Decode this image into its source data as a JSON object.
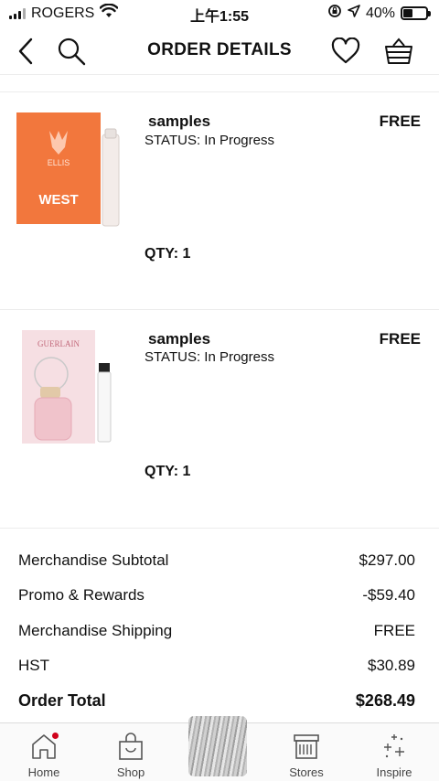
{
  "status_bar": {
    "carrier": "ROGERS",
    "time": "上午1:55",
    "battery_percent": "40%",
    "battery_level": 0.4
  },
  "nav": {
    "title": "ORDER DETAILS",
    "back_icon": "chevron-left-icon",
    "search_icon": "search-icon",
    "wishlist_icon": "heart-icon",
    "basket_icon": "basket-icon"
  },
  "items": [
    {
      "name": "samples",
      "status": "STATUS: In Progress",
      "price": "FREE",
      "qty": "QTY: 1",
      "thumb_brand": "ELLIS",
      "thumb_product": "WEST",
      "thumb_color": "#f2773d"
    },
    {
      "name": "samples",
      "status": "STATUS: In Progress",
      "price": "FREE",
      "qty": "QTY: 1",
      "thumb_brand": "GUERLAIN",
      "thumb_color": "#f6dfe3"
    }
  ],
  "summary": {
    "rows": [
      {
        "label": "Merchandise Subtotal",
        "value": "$297.00"
      },
      {
        "label": "Promo & Rewards",
        "value": "-$59.40"
      },
      {
        "label": "Merchandise Shipping",
        "value": "FREE"
      },
      {
        "label": "HST",
        "value": "$30.89"
      }
    ],
    "total_label": "Order Total",
    "total_value": "$268.49"
  },
  "tabs": [
    {
      "label": "Home",
      "icon": "home-icon"
    },
    {
      "label": "Shop",
      "icon": "shopping-bag-icon"
    },
    {
      "label": "Stores",
      "icon": "store-icon"
    },
    {
      "label": "Inspire",
      "icon": "sparkle-icon"
    }
  ],
  "colors": {
    "notification_dot": "#d0021b",
    "divider": "#ececec"
  }
}
